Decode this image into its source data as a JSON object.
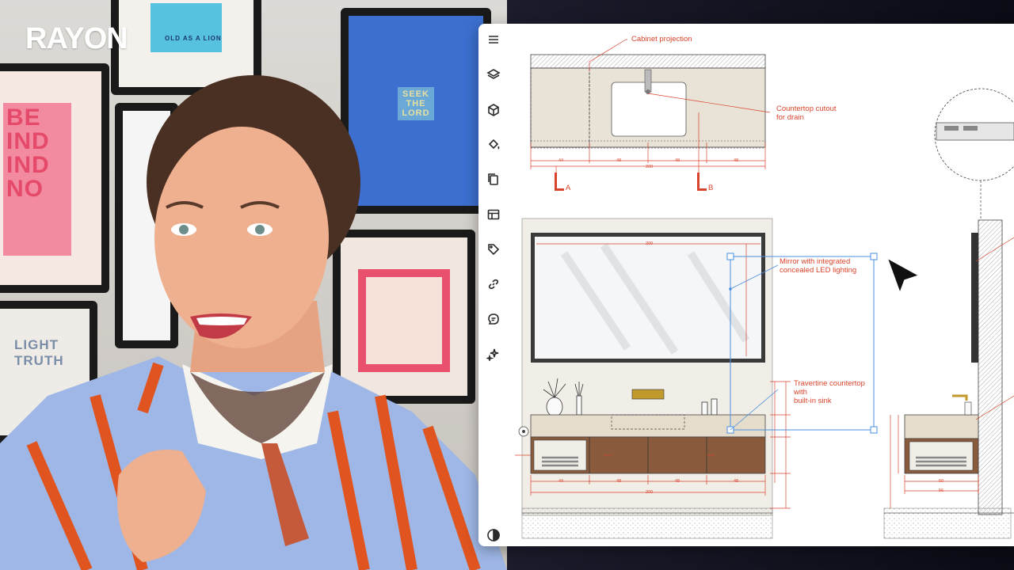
{
  "brand": {
    "logo_text": "RAYON"
  },
  "posters": {
    "p1_line1": "BE",
    "p1_line2": "IND",
    "p1_line3": "IND",
    "p1_line4": "NO",
    "p2_line1": "LIGHT",
    "p2_line2": "TRUTH",
    "p3_text": "OLD AS A LION",
    "p4_line1": "SEEK",
    "p4_line2": "THE",
    "p4_line3": "LORD"
  },
  "toolbar": {
    "items": [
      {
        "name": "menu-icon"
      },
      {
        "name": "layers-icon"
      },
      {
        "name": "cube-icon"
      },
      {
        "name": "paint-bucket-icon"
      },
      {
        "name": "pages-icon"
      },
      {
        "name": "table-icon"
      },
      {
        "name": "tag-icon"
      },
      {
        "name": "link-icon"
      },
      {
        "name": "comment-icon"
      },
      {
        "name": "sparkle-icon"
      },
      {
        "name": "contrast-icon"
      }
    ]
  },
  "annotations": {
    "cabinet_projection": "Cabinet projection",
    "countertop_cutout_l1": "Countertop cutout",
    "countertop_cutout_l2": "for drain",
    "mirror_l1": "Mirror with integrated",
    "mirror_l2": "concealed LED lighting",
    "travertine_l1": "Travertine countertop",
    "travertine_l2": "with",
    "travertine_l3": "built-in sink",
    "section_a": "A",
    "section_b": "B"
  },
  "dimensions": {
    "plan": [
      "44",
      "48",
      "48",
      "48"
    ],
    "plan_total": "200",
    "mirror_width": "200",
    "elev": [
      "44",
      "48",
      "48",
      "48"
    ],
    "elev_total": "200",
    "side": [
      "60",
      "56"
    ]
  },
  "colors": {
    "accent": "#d8432b",
    "selection": "#4a8fe0"
  }
}
